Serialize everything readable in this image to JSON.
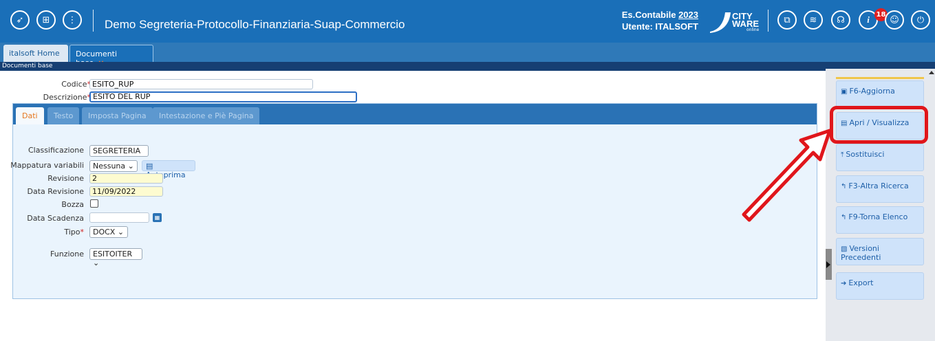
{
  "header": {
    "app_title": "Demo Segreteria-Protocollo-Finanziaria-Suap-Commercio",
    "es_contabile_label": "Es.Contabile",
    "es_contabile_year": "2023",
    "utente": "Utente: ITALSOFT",
    "logo_text_1": "CITY",
    "logo_text_2": "WARE",
    "logo_text_3": "online",
    "notification_count": "18",
    "icons": [
      "rocket-icon",
      "apps-grid-icon",
      "info-icon",
      "window-icon",
      "stack-icon",
      "headset-icon",
      "help-icon",
      "user-icon",
      "power-icon"
    ]
  },
  "tabs": [
    {
      "label": "italsoft Home"
    },
    {
      "label": "Documenti base",
      "close": "×"
    }
  ],
  "breadcrumb": "Documenti base",
  "form": {
    "codice_label": "Codice",
    "codice_value": "ESITO_RUP",
    "descrizione_label": "Descrizione",
    "descrizione_value": "ESITO DEL RUP",
    "required_mark": "*"
  },
  "panel_tabs": [
    "Dati",
    "Testo",
    "Imposta Pagina",
    "Intestazione e Piè Pagina"
  ],
  "dati": {
    "classificazione_label": "Classificazione",
    "classificazione_value": "SEGRETERIA",
    "mappatura_label": "Mappatura variabili",
    "mappatura_value": "Nessuna",
    "anteprima_label": "Anteprima",
    "revisione_label": "Revisione",
    "revisione_value": "2",
    "data_revisione_label": "Data Revisione",
    "data_revisione_value": "11/09/2022",
    "bozza_label": "Bozza",
    "data_scadenza_label": "Data Scadenza",
    "data_scadenza_value": "",
    "tipo_label": "Tipo",
    "tipo_value": "DOCX",
    "funzione_label": "Funzione",
    "funzione_value": "ESITOITER"
  },
  "actions": [
    {
      "label": "F6-Aggiorna",
      "icon": "save-icon"
    },
    {
      "label": "Apri / Visualizza",
      "icon": "file-icon"
    },
    {
      "label": "Sostituisci",
      "icon": "upload-icon"
    },
    {
      "label": "F3-Altra Ricerca",
      "icon": "back-icon"
    },
    {
      "label": "F9-Torna Elenco",
      "icon": "back-icon"
    },
    {
      "label": "Versioni Precedenti",
      "icon": "versions-icon"
    },
    {
      "label": "Export",
      "icon": "export-icon"
    }
  ],
  "annotation": {
    "highlight_color": "#e0161b"
  }
}
